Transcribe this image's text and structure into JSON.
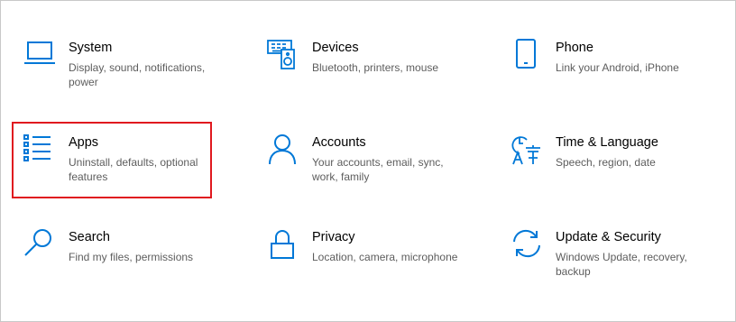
{
  "accent_color": "#0078d7",
  "highlight_color": "#e0191f",
  "tiles": [
    {
      "name": "system",
      "icon": "laptop-icon",
      "title": "System",
      "desc": "Display, sound, notifications, power"
    },
    {
      "name": "devices",
      "icon": "keyboard-speaker-icon",
      "title": "Devices",
      "desc": "Bluetooth, printers, mouse"
    },
    {
      "name": "phone",
      "icon": "phone-icon",
      "title": "Phone",
      "desc": "Link your Android, iPhone"
    },
    {
      "name": "apps",
      "icon": "apps-list-icon",
      "title": "Apps",
      "desc": "Uninstall, defaults, optional features"
    },
    {
      "name": "accounts",
      "icon": "person-icon",
      "title": "Accounts",
      "desc": "Your accounts, email, sync, work, family"
    },
    {
      "name": "time-language",
      "icon": "time-language-icon",
      "title": "Time & Language",
      "desc": "Speech, region, date"
    },
    {
      "name": "search",
      "icon": "search-icon",
      "title": "Search",
      "desc": "Find my files, permissions"
    },
    {
      "name": "privacy",
      "icon": "lock-icon",
      "title": "Privacy",
      "desc": "Location, camera, microphone"
    },
    {
      "name": "update-security",
      "icon": "sync-icon",
      "title": "Update & Security",
      "desc": "Windows Update, recovery, backup"
    }
  ]
}
